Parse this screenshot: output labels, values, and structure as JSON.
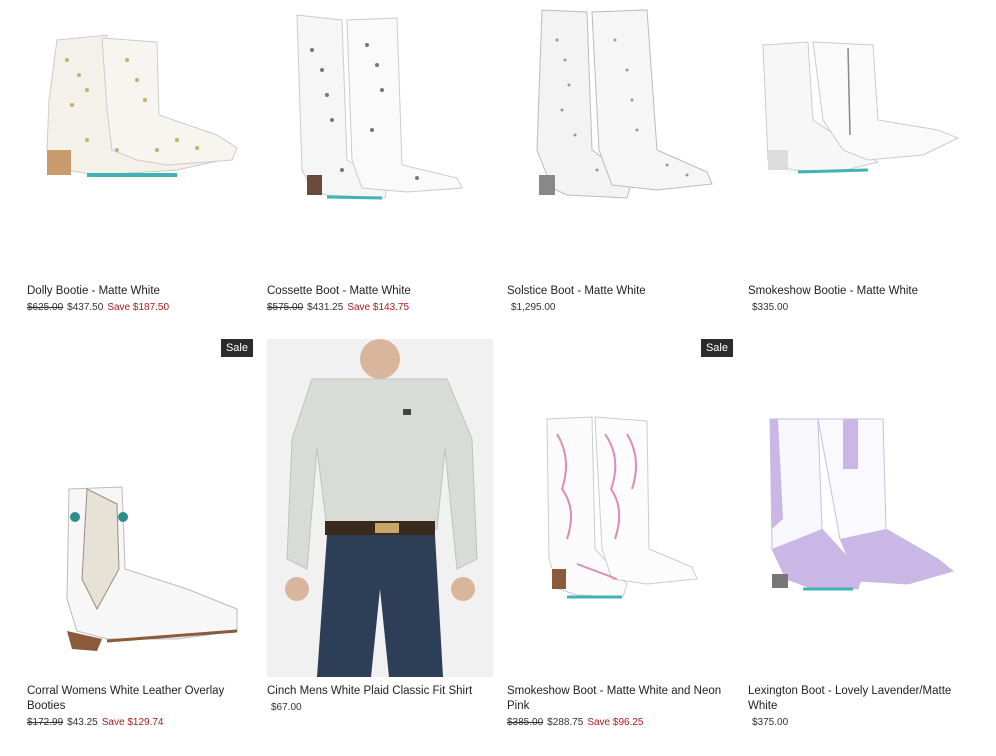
{
  "products": [
    {
      "title": "Dolly Bootie - Matte White",
      "was": "$625.00",
      "price": "$437.50",
      "save": "Save $187.50",
      "badge": "",
      "icon": "studded-bootie-gold-icon"
    },
    {
      "title": "Cossette Boot - Matte White",
      "was": "$575.00",
      "price": "$431.25",
      "save": "Save $143.75",
      "badge": "",
      "icon": "studded-boot-icon"
    },
    {
      "title": "Solstice Boot - Matte White",
      "was": "",
      "price": "$1,295.00",
      "save": "",
      "badge": "",
      "icon": "crystal-boot-icon"
    },
    {
      "title": "Smokeshow Bootie - Matte White",
      "was": "",
      "price": "$335.00",
      "save": "",
      "badge": "",
      "icon": "bootie-icon"
    },
    {
      "title": "Corral Womens White Leather Overlay Booties",
      "was": "$172.99",
      "price": "$43.25",
      "save": "Save $129.74",
      "badge": "Sale",
      "icon": "overlay-bootie-icon"
    },
    {
      "title": "Cinch Mens White Plaid Classic Fit Shirt",
      "was": "",
      "price": "$67.00",
      "save": "",
      "badge": "",
      "icon": "shirt-model-icon"
    },
    {
      "title": "Smokeshow Boot - Matte White and Neon Pink",
      "was": "$385.00",
      "price": "$288.75",
      "save": "Save $96.25",
      "badge": "Sale",
      "icon": "pink-stitch-boot-icon"
    },
    {
      "title": "Lexington Boot - Lovely Lavender/Matte White",
      "was": "",
      "price": "$375.00",
      "save": "",
      "badge": "",
      "icon": "lavender-boot-icon"
    }
  ]
}
